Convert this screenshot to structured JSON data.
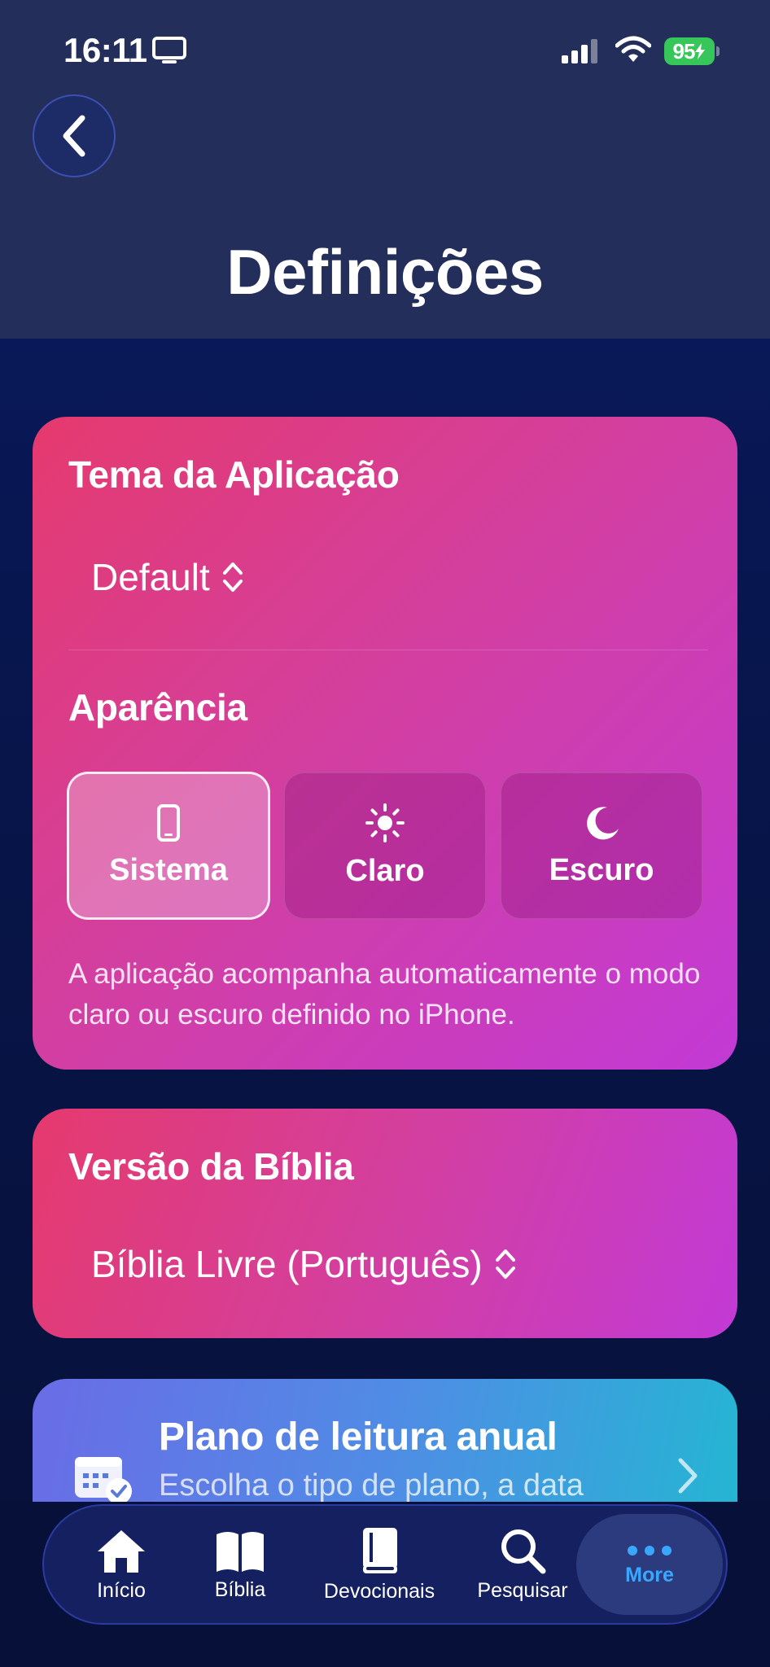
{
  "status_bar": {
    "time": "16:11",
    "battery": "95",
    "icons": [
      "screen-mirroring-icon",
      "cellular-signal-icon",
      "wifi-icon",
      "battery-charging-icon"
    ]
  },
  "header": {
    "back_icon": "chevron-left-icon",
    "title": "Definições"
  },
  "theme_card": {
    "heading": "Tema da Aplicação",
    "theme_value": "Default",
    "appearance_heading": "Aparência",
    "options": [
      {
        "label": "Sistema",
        "icon": "phone-icon",
        "selected": true
      },
      {
        "label": "Claro",
        "icon": "sun-icon",
        "selected": false
      },
      {
        "label": "Escuro",
        "icon": "moon-icon",
        "selected": false
      }
    ],
    "description": "A aplicação acompanha automaticamente o modo claro ou escuro definido no iPhone."
  },
  "bible_card": {
    "heading": "Versão da Bíblia",
    "version_value": "Bíblia Livre (Português)"
  },
  "plan_card": {
    "title": "Plano de leitura anual",
    "subtitle": "Escolha o tipo de plano, a data"
  },
  "tab_bar": {
    "items": [
      {
        "label": "Início",
        "icon": "house-icon"
      },
      {
        "label": "Bíblia",
        "icon": "open-book-icon"
      },
      {
        "label": "Devocionais",
        "icon": "book-icon"
      },
      {
        "label": "Pesquisar",
        "icon": "search-icon"
      },
      {
        "label": "More",
        "icon": "ellipsis-icon",
        "active": true
      }
    ]
  },
  "colors": {
    "active_tab": "#3aa7ff",
    "battery_green": "#36c659"
  }
}
